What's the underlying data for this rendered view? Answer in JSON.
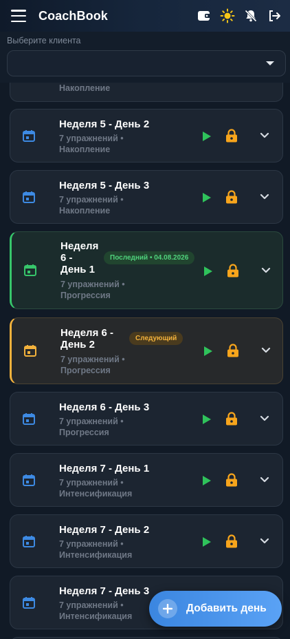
{
  "app": {
    "title": "CoachBook"
  },
  "header": {
    "icons": [
      "menu-icon",
      "wallet-icon",
      "sun-icon",
      "bell-off-icon",
      "logout-icon"
    ]
  },
  "client": {
    "label": "Выберите клиента",
    "value": ""
  },
  "colors": {
    "accent": "#3d8ae3",
    "done": "#37c66b",
    "next": "#f3b23c",
    "lock": "#f7a51c",
    "play": "#2fc25b"
  },
  "workouts": [
    {
      "title": "",
      "subtitle1": "",
      "subtitle2": "Накопление",
      "status": "partial"
    },
    {
      "title": "Неделя 5 - День 2",
      "subtitle1": "7 упражнений •",
      "subtitle2": "Накопление",
      "status": "locked"
    },
    {
      "title": "Неделя 5 - День 3",
      "subtitle1": "7 упражнений •",
      "subtitle2": "Накопление",
      "status": "locked"
    },
    {
      "title_lines": [
        "Неделя",
        "6 -",
        "День 1"
      ],
      "subtitle1": "7 упражнений •",
      "subtitle2": "Прогрессия",
      "status": "done",
      "badge": "Последний • 04.08.2026"
    },
    {
      "title_lines": [
        "Неделя 6 -",
        "День 2"
      ],
      "subtitle1": "7 упражнений •",
      "subtitle2": "Прогрессия",
      "status": "next",
      "badge": "Следующий"
    },
    {
      "title": "Неделя 6 - День 3",
      "subtitle1": "7 упражнений •",
      "subtitle2": "Прогрессия",
      "status": "locked"
    },
    {
      "title": "Неделя 7 - День 1",
      "subtitle1": "7 упражнений •",
      "subtitle2": "Интенсификация",
      "status": "locked"
    },
    {
      "title": "Неделя 7 - День 2",
      "subtitle1": "7 упражнений •",
      "subtitle2": "Интенсификация",
      "status": "locked"
    },
    {
      "title": "Неделя 7 - День 3",
      "subtitle1": "7 упражнений •",
      "subtitle2": "Интенсификация",
      "status": "locked"
    }
  ],
  "fab": {
    "label": "Добавить день"
  }
}
